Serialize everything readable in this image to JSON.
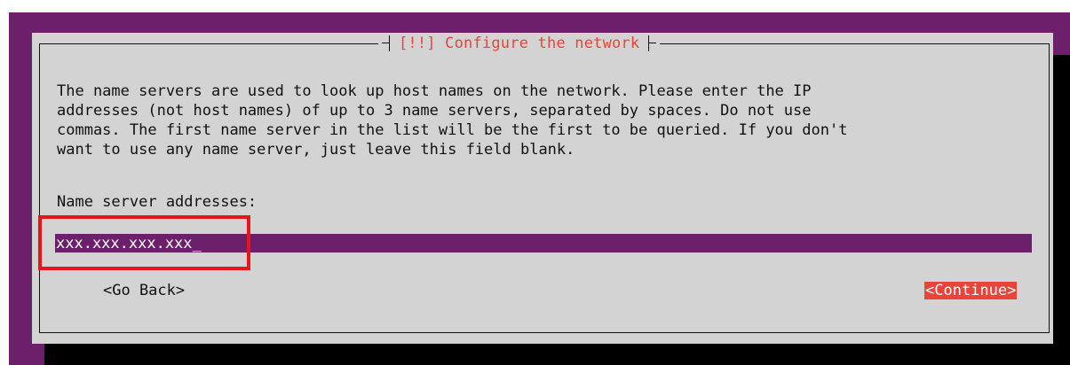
{
  "dialog": {
    "title": "[!!] Configure the network",
    "description_lines": [
      "The name servers are used to look up host names on the network. Please enter the IP",
      "addresses (not host names) of up to 3 name servers, separated by spaces. Do not use",
      "commas. The first name server in the list will be the first to be queried. If you don't",
      "want to use any name server, just leave this field blank."
    ],
    "field_label": "Name server addresses:",
    "input_value": "xxx.xxx.xxx.xxx_"
  },
  "buttons": {
    "back": "<Go Back>",
    "continue": "<Continue>"
  },
  "colors": {
    "background": "#6c1f6a",
    "dialog": "#d3d3d3",
    "accent": "#e8443a",
    "highlight_box": "#e8141b"
  }
}
